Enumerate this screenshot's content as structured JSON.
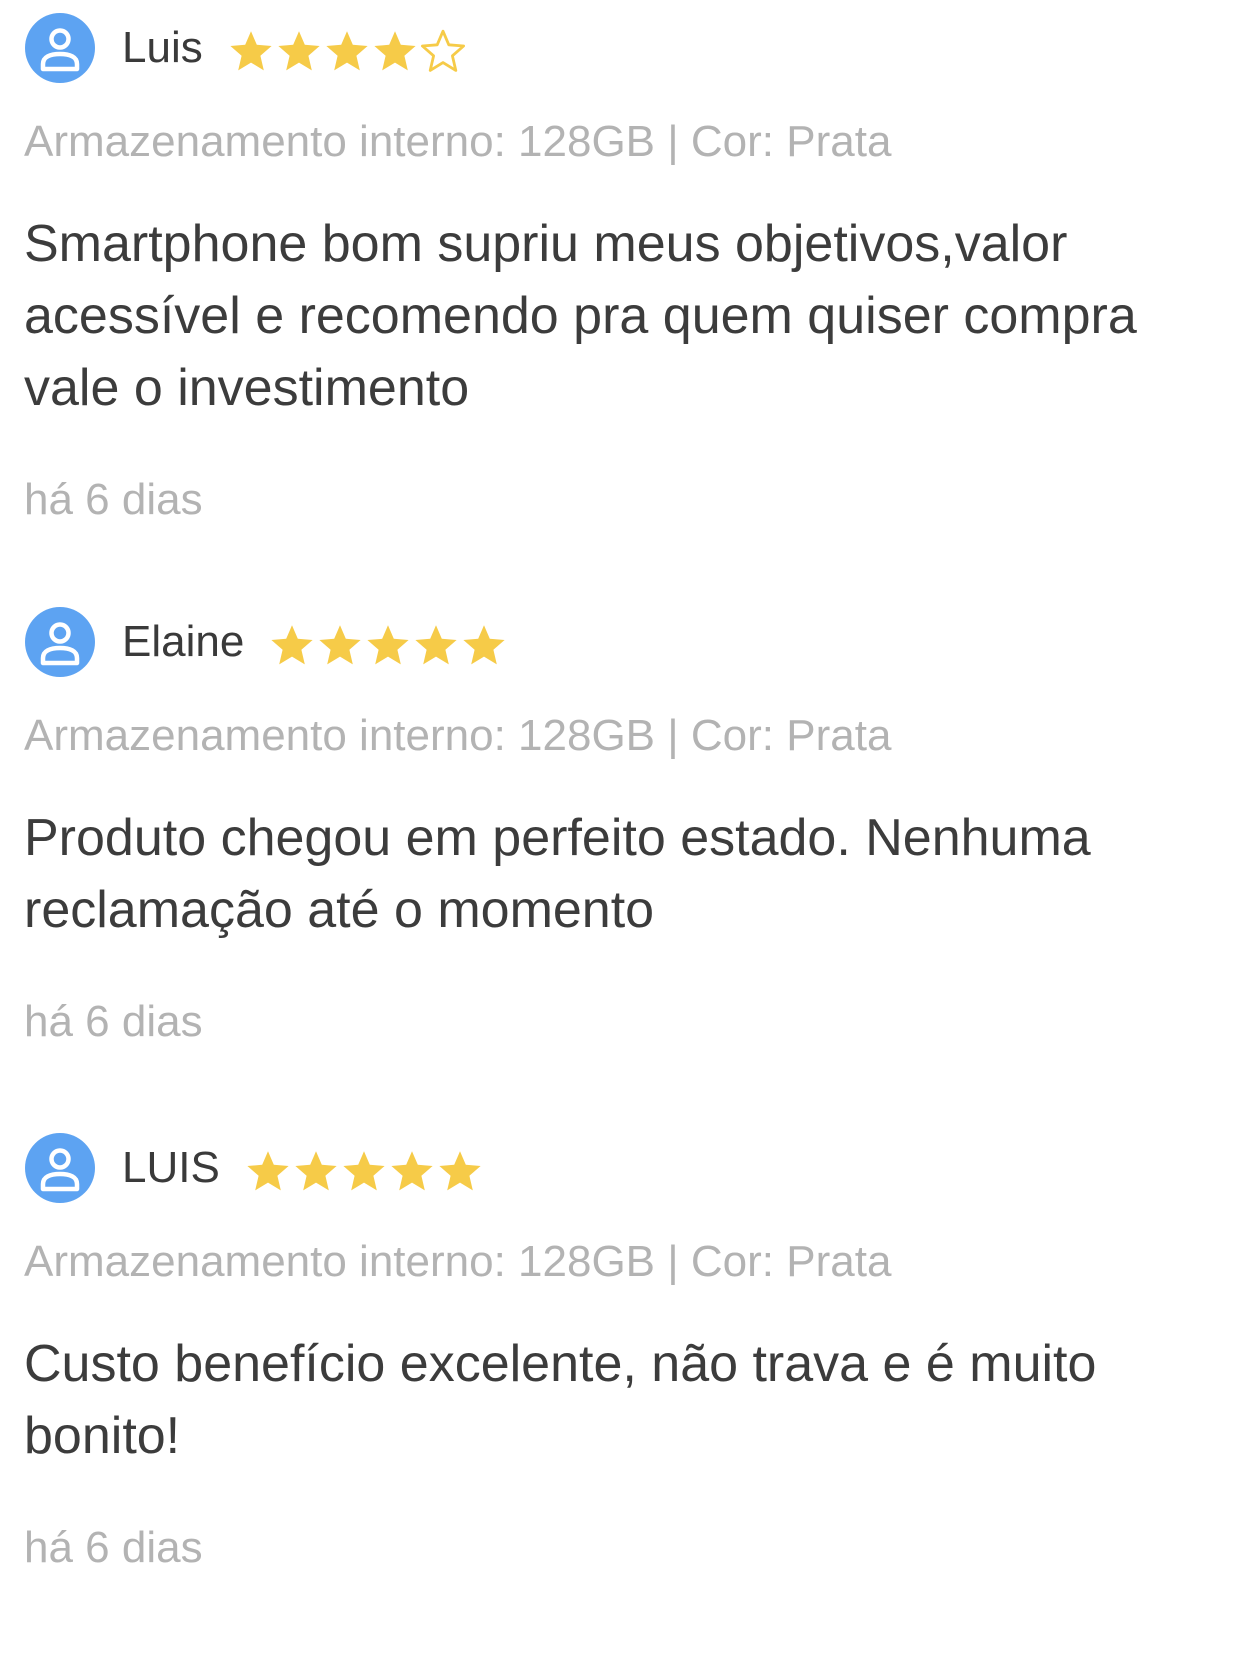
{
  "colors": {
    "star": "#F6CB48",
    "avatar": "#5DA3F2",
    "name": "#3A3A3A",
    "muted": "#B3B3B3",
    "body_text": "#3C3C3C"
  },
  "icons": {
    "avatar": "user-avatar-icon",
    "star_filled": "star-filled-icon",
    "star_empty": "star-outline-icon"
  },
  "reviews": [
    {
      "name": "Luis",
      "rating": 4,
      "variant": "Armazenamento interno: 128GB | Cor: Prata",
      "text_lines": [
        "Smartphone bom supriu meus objetivos,valor",
        "acessível e recomendo pra quem quiser compra",
        "vale o investimento"
      ],
      "date": "há 6 dias"
    },
    {
      "name": "Elaine",
      "rating": 5,
      "variant": "Armazenamento interno: 128GB | Cor: Prata",
      "text_lines": [
        "Produto chegou em perfeito estado. Nenhuma",
        "reclamação até o momento"
      ],
      "date": "há 6 dias"
    },
    {
      "name": "LUIS",
      "rating": 5,
      "variant": "Armazenamento interno: 128GB | Cor: Prata",
      "text_lines": [
        "Custo benefício excelente, não trava e é muito",
        "bonito!"
      ],
      "date": "há 6 dias"
    }
  ]
}
